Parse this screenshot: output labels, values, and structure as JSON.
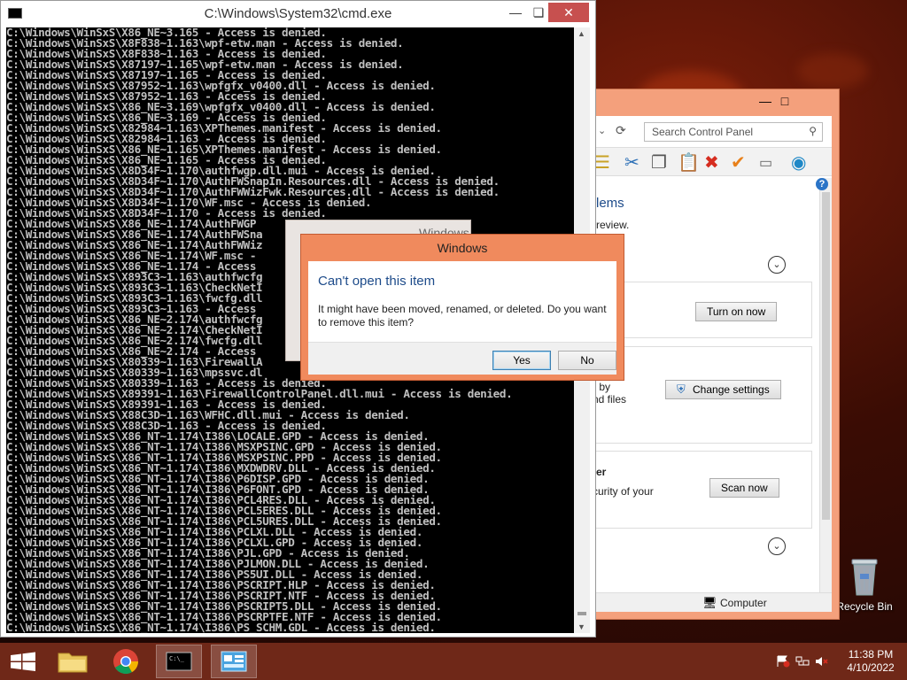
{
  "cmd": {
    "title": "C:\\Windows\\System32\\cmd.exe",
    "lines": [
      "C:\\Windows\\WinSxS\\X86_NE~3.165 - Access is denied.",
      "C:\\Windows\\WinSxS\\X8F838~1.163\\wpf-etw.man - Access is denied.",
      "C:\\Windows\\WinSxS\\X8F838~1.163 - Access is denied.",
      "C:\\Windows\\WinSxS\\X87197~1.165\\wpf-etw.man - Access is denied.",
      "C:\\Windows\\WinSxS\\X87197~1.165 - Access is denied.",
      "C:\\Windows\\WinSxS\\X87952~1.163\\wpfgfx_v0400.dll - Access is denied.",
      "C:\\Windows\\WinSxS\\X87952~1.163 - Access is denied.",
      "C:\\Windows\\WinSxS\\X86_NE~3.169\\wpfgfx_v0400.dll - Access is denied.",
      "C:\\Windows\\WinSxS\\X86_NE~3.169 - Access is denied.",
      "C:\\Windows\\WinSxS\\X82984~1.163\\XPThemes.manifest - Access is denied.",
      "C:\\Windows\\WinSxS\\X82984~1.163 - Access is denied.",
      "C:\\Windows\\WinSxS\\X86_NE~1.165\\XPThemes.manifest - Access is denied.",
      "C:\\Windows\\WinSxS\\X86_NE~1.165 - Access is denied.",
      "C:\\Windows\\WinSxS\\X8D34F~1.170\\authfwgp.dll.mui - Access is denied.",
      "C:\\Windows\\WinSxS\\X8D34F~1.170\\AuthFWSnapIn.Resources.dll - Access is denied.",
      "C:\\Windows\\WinSxS\\X8D34F~1.170\\AuthFWWizFwk.Resources.dll - Access is denied.",
      "C:\\Windows\\WinSxS\\X8D34F~1.170\\WF.msc - Access is denied.",
      "C:\\Windows\\WinSxS\\X8D34F~1.170 - Access is denied.",
      "C:\\Windows\\WinSxS\\X86_NE~1.174\\AuthFWGP",
      "C:\\Windows\\WinSxS\\X86_NE~1.174\\AuthFWSna",
      "C:\\Windows\\WinSxS\\X86_NE~1.174\\AuthFWWiz",
      "C:\\Windows\\WinSxS\\X86_NE~1.174\\WF.msc -",
      "C:\\Windows\\WinSxS\\X86_NE~1.174 - Access",
      "C:\\Windows\\WinSxS\\X893C3~1.163\\authfwcfg",
      "C:\\Windows\\WinSxS\\X893C3~1.163\\CheckNetI",
      "C:\\Windows\\WinSxS\\X893C3~1.163\\fwcfg.dll",
      "C:\\Windows\\WinSxS\\X893C3~1.163 - Access",
      "C:\\Windows\\WinSxS\\X86_NE~2.174\\authfwcfg",
      "C:\\Windows\\WinSxS\\X86_NE~2.174\\CheckNetI",
      "C:\\Windows\\WinSxS\\X86_NE~2.174\\fwcfg.dll",
      "C:\\Windows\\WinSxS\\X86_NE~2.174 - Access",
      "C:\\Windows\\WinSxS\\X80339~1.163\\FirewallA",
      "C:\\Windows\\WinSxS\\X80339~1.163\\mpssvc.dl",
      "C:\\Windows\\WinSxS\\X80339~1.163 - Access is denied.",
      "C:\\Windows\\WinSxS\\X89391~1.163\\FirewallControlPanel.dll.mui - Access is denied.",
      "C:\\Windows\\WinSxS\\X89391~1.163 - Access is denied.",
      "C:\\Windows\\WinSxS\\X88C3D~1.163\\WFHC.dll.mui - Access is denied.",
      "C:\\Windows\\WinSxS\\X88C3D~1.163 - Access is denied.",
      "C:\\Windows\\WinSxS\\X86_NT~1.174\\I386\\LOCALE.GPD - Access is denied.",
      "C:\\Windows\\WinSxS\\X86_NT~1.174\\I386\\MSXPSINC.GPD - Access is denied.",
      "C:\\Windows\\WinSxS\\X86_NT~1.174\\I386\\MSXPSINC.PPD - Access is denied.",
      "C:\\Windows\\WinSxS\\X86_NT~1.174\\I386\\MXDWDRV.DLL - Access is denied.",
      "C:\\Windows\\WinSxS\\X86_NT~1.174\\I386\\P6DISP.GPD - Access is denied.",
      "C:\\Windows\\WinSxS\\X86_NT~1.174\\I386\\P6FONT.GPD - Access is denied.",
      "C:\\Windows\\WinSxS\\X86_NT~1.174\\I386\\PCL4RES.DLL - Access is denied.",
      "C:\\Windows\\WinSxS\\X86_NT~1.174\\I386\\PCL5ERES.DLL - Access is denied.",
      "C:\\Windows\\WinSxS\\X86_NT~1.174\\I386\\PCL5URES.DLL - Access is denied.",
      "C:\\Windows\\WinSxS\\X86_NT~1.174\\I386\\PCLXL.DLL - Access is denied.",
      "C:\\Windows\\WinSxS\\X86_NT~1.174\\I386\\PCLXL.GPD - Access is denied.",
      "C:\\Windows\\WinSxS\\X86_NT~1.174\\I386\\PJL.GPD - Access is denied.",
      "C:\\Windows\\WinSxS\\X86_NT~1.174\\I386\\PJLMON.DLL - Access is denied.",
      "C:\\Windows\\WinSxS\\X86_NT~1.174\\I386\\PS5UI.DLL - Access is denied.",
      "C:\\Windows\\WinSxS\\X86_NT~1.174\\I386\\PSCRIPT.HLP - Access is denied.",
      "C:\\Windows\\WinSxS\\X86_NT~1.174\\I386\\PSCRIPT.NTF - Access is denied.",
      "C:\\Windows\\WinSxS\\X86_NT~1.174\\I386\\PSCRIPT5.DLL - Access is denied.",
      "C:\\Windows\\WinSxS\\X86_NT~1.174\\I386\\PSCRPTFE.NTF - Access is denied.",
      "C:\\Windows\\WinSxS\\X86_NT~1.174\\I386\\PS_SCHM.GDL - Access is denied."
    ]
  },
  "ghost_dialog": {
    "title": "Windows"
  },
  "dialog": {
    "title": "Windows",
    "heading": "Can't open this item",
    "message": "It might have been moved, renamed, or deleted. Do you want to remove this item?",
    "yes_label": "Yes",
    "no_label": "No"
  },
  "control_panel": {
    "search_placeholder": "Search Control Panel",
    "header_fragment": "lems",
    "subheader_fragment": "review.",
    "section1_button": "Turn on now",
    "section2_line1": "r by",
    "section2_line2": "nd files",
    "section2_button": "Change settings",
    "section3_title": "ter",
    "section3_line": "curity of your",
    "section3_button": "Scan now",
    "status_text": "Computer"
  },
  "desktop": {
    "recycle_bin_label": "Recycle Bin"
  },
  "taskbar": {
    "time": "11:38 PM",
    "date": "4/10/2022"
  },
  "colors": {
    "accent_window": "#f4a07c",
    "dialog_frame": "#f08a5d",
    "taskbar": "#6f2818",
    "close_button": "#c7504f",
    "dialog_heading": "#1d4b8a"
  }
}
